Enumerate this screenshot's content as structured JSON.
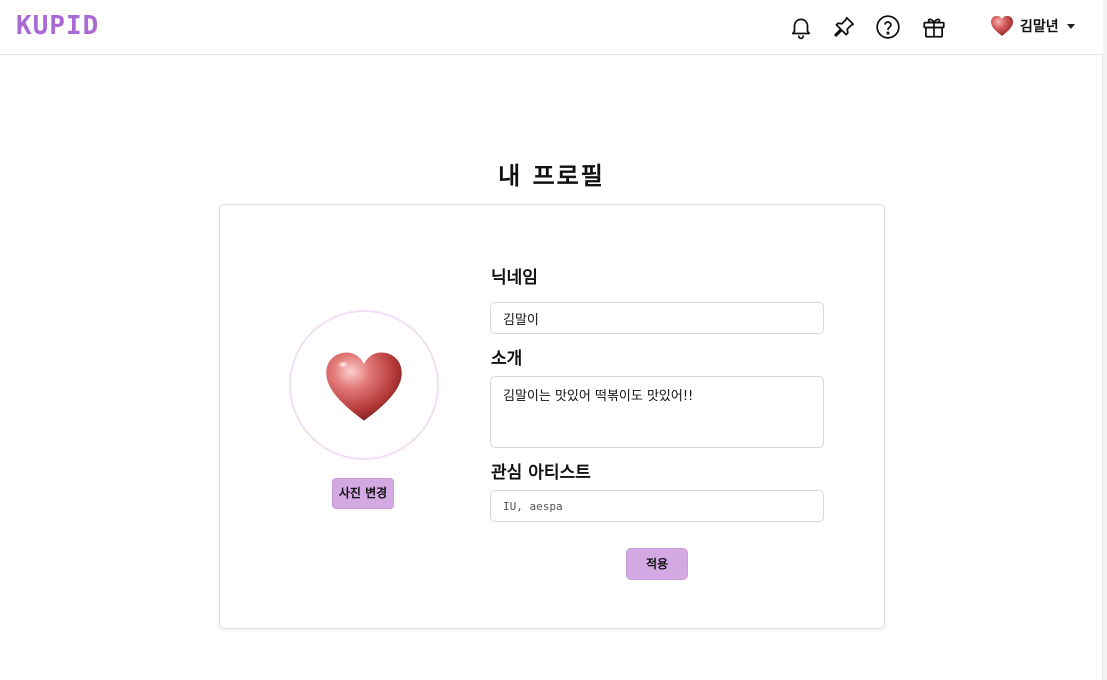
{
  "header": {
    "logo": "KUPID",
    "icons": [
      "bell-icon",
      "pin-icon",
      "help-icon",
      "gift-icon"
    ],
    "user": {
      "name": "김말년",
      "avatar_icon": "heart-icon"
    }
  },
  "page": {
    "title": "내 프로필"
  },
  "profile": {
    "avatar_icon": "heart-icon",
    "change_photo_label": "사진 변경",
    "nickname_label": "닉네임",
    "nickname_value": "김말이",
    "intro_label": "소개",
    "intro_value": "김말이는 맛있어 떡볶이도 맛있어!!",
    "artists_label": "관심 아티스트",
    "artists_placeholder": "IU, aespa",
    "apply_label": "적용"
  },
  "colors": {
    "accent": "#a96ad6",
    "button_bg": "#d4a9e3",
    "avatar_ring": "#f1dff6"
  }
}
